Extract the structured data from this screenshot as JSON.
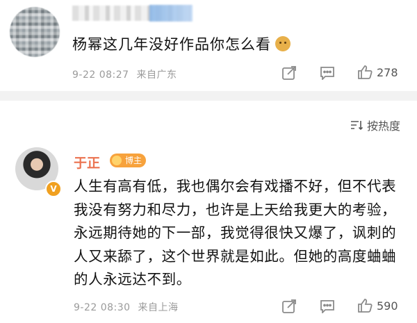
{
  "post": {
    "text": "杨幂这几年没好作品你怎么看",
    "emoji": "doge-emoji",
    "time": "9-22 08:27",
    "location": "来自广东",
    "like_count": "278"
  },
  "sort": {
    "label": "按热度"
  },
  "comment": {
    "author": "于正",
    "badge": "博主",
    "text": "人生有高有低，我也偶尔会有戏播不好，但不代表我没有努力和尽力，也许是上天给我更大的考验，永远期待她的下一部，我觉得很快又爆了，讽刺的人又来舔了，这个世界就是如此。但她的高度蛐蛐的人永远达不到。",
    "time": "9-22 08:30",
    "location": "来自上海",
    "like_count": "590"
  },
  "icons": [
    "share-icon",
    "comment-icon",
    "like-icon",
    "sort-icon",
    "verified-icon",
    "badge-icon"
  ]
}
